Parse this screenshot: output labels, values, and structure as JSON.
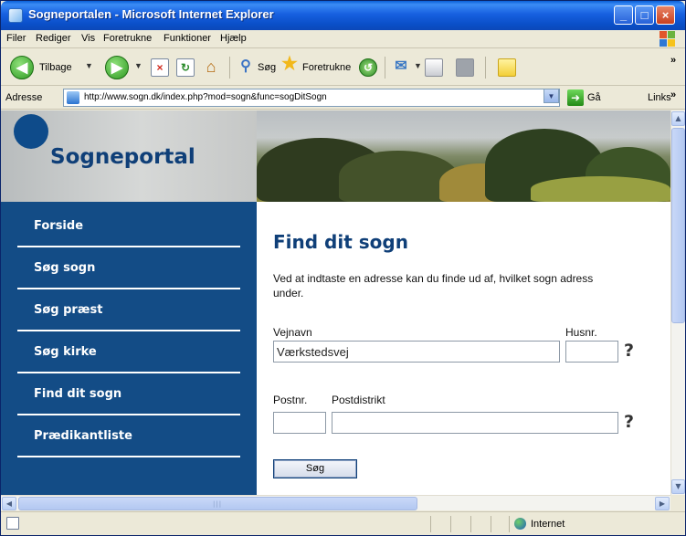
{
  "window": {
    "title": "Sogneportalen - Microsoft Internet Explorer",
    "minimize_glyph": "_",
    "maximize_glyph": "□",
    "close_glyph": "×"
  },
  "menu": [
    "Filer",
    "Rediger",
    "Vis",
    "Foretrukne",
    "Funktioner",
    "Hjælp"
  ],
  "toolbar": {
    "back_label": "Tilbage",
    "search_label": "Søg",
    "favorites_label": "Foretrukne",
    "chevron": "»"
  },
  "address": {
    "label": "Adresse",
    "url": "http://www.sogn.dk/index.php?mod=sogn&func=sogDitSogn",
    "go_label": "Gå",
    "links_label": "Links",
    "chevron": "»"
  },
  "site": {
    "logo_text": "Sogneportal"
  },
  "nav": [
    "Forside",
    "Søg sogn",
    "Søg præst",
    "Søg kirke",
    "Find dit sogn",
    "Prædikantliste"
  ],
  "page": {
    "title": "Find dit sogn",
    "intro_line1": "Ved at indtaste en adresse kan du finde ud af, hvilket sogn adress",
    "intro_line2": "under.",
    "vejnavn_label": "Vejnavn",
    "vejnavn_value": "Værkstedsvej",
    "husnr_label": "Husnr.",
    "husnr_value": "",
    "postnr_label": "Postnr.",
    "postnr_value": "",
    "postdistrikt_label": "Postdistrikt",
    "postdistrikt_value": "",
    "help_glyph": "?",
    "search_button": "Søg"
  },
  "status": {
    "zone": "Internet"
  }
}
